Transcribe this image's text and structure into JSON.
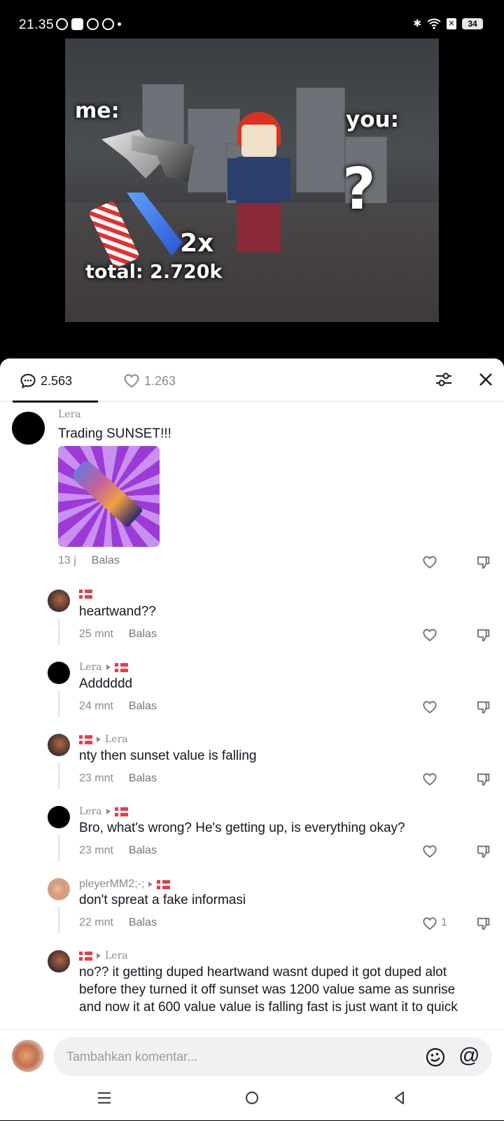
{
  "status_bar": {
    "time": "21.35",
    "battery": "34"
  },
  "video": {
    "label_me": "me:",
    "label_you": "you:",
    "label_question": "?",
    "label_multiplier": "2x",
    "label_total": "total: 2.720k"
  },
  "tabs": {
    "comments_count": "2.563",
    "likes_count": "1.263"
  },
  "comments": [
    {
      "author": "Lera",
      "reply_to": "",
      "text": "Trading SUNSET!!!",
      "time": "13 j",
      "reply_label": "Balas",
      "likes": ""
    },
    {
      "author": "",
      "reply_to": "",
      "text": "heartwand??",
      "time": "25 mnt",
      "reply_label": "Balas",
      "likes": ""
    },
    {
      "author": "Lera",
      "reply_to": "",
      "text": "Adddddd",
      "time": "24 mnt",
      "reply_label": "Balas",
      "likes": ""
    },
    {
      "author": "",
      "reply_to": "Lera",
      "text": "nty then sunset value is falling",
      "time": "23 mnt",
      "reply_label": "Balas",
      "likes": ""
    },
    {
      "author": "Lera",
      "reply_to": "",
      "text": "Bro, what's wrong? He's getting up, is everything okay?",
      "time": "23 mnt",
      "reply_label": "Balas",
      "likes": ""
    },
    {
      "author": "pleyerMM2;-;",
      "reply_to": "",
      "text": "don't spreat a fake informasi",
      "time": "22 mnt",
      "reply_label": "Balas",
      "likes": "1"
    },
    {
      "author": "",
      "reply_to": "Lera",
      "text_lines": [
        "no?? it getting duped heartwand wasnt duped it got duped alot",
        "before they turned it off sunset was 1200 value same as sunrise",
        "and now it at 600 value value is falling fast is just want it to quick"
      ]
    }
  ],
  "input": {
    "placeholder": "Tambahkan komentar..."
  },
  "colors": {
    "accent": "#161823",
    "muted": "#8a8b91",
    "flag_red": "#e04050"
  }
}
